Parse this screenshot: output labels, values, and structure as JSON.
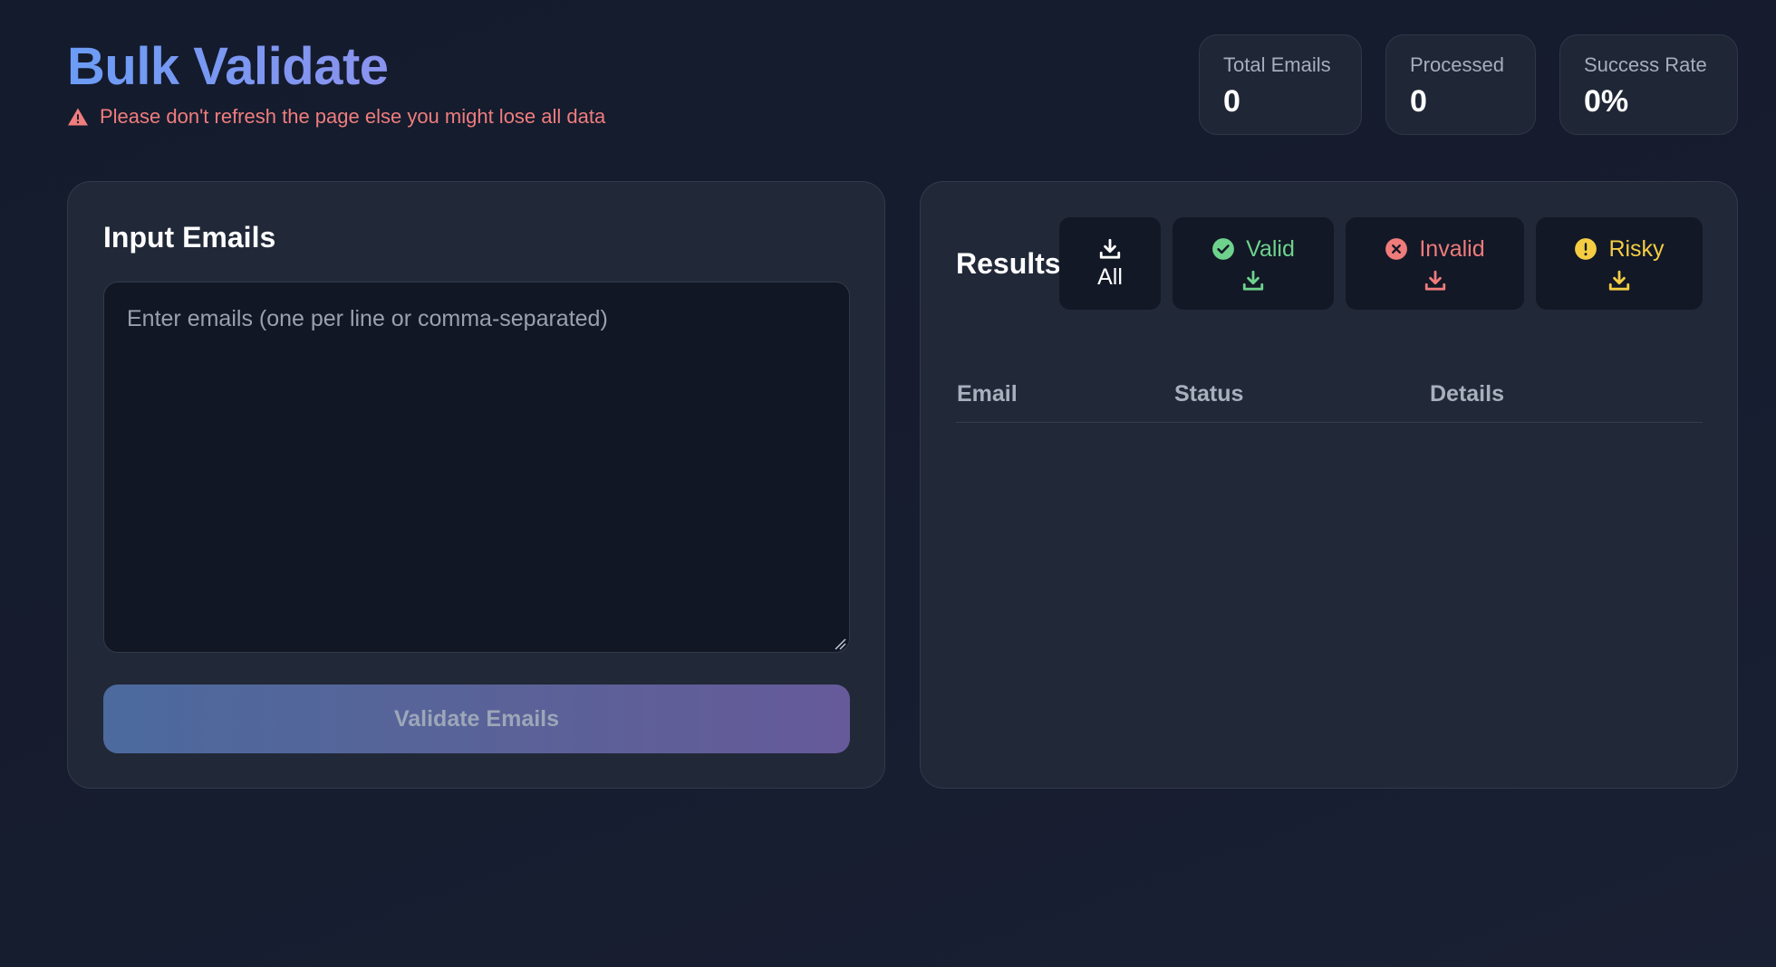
{
  "header": {
    "title": "Bulk Validate",
    "warning": "Please don't refresh the page else you might lose all data"
  },
  "stats": [
    {
      "label": "Total Emails",
      "value": "0"
    },
    {
      "label": "Processed",
      "value": "0"
    },
    {
      "label": "Success Rate",
      "value": "0%"
    }
  ],
  "input_panel": {
    "title": "Input Emails",
    "textarea_value": "",
    "textarea_placeholder": "Enter emails (one per line or comma-separated)",
    "validate_label": "Validate Emails"
  },
  "results_panel": {
    "title": "Results",
    "downloads": {
      "all": "All",
      "valid": "Valid",
      "invalid": "Invalid",
      "risky": "Risky"
    },
    "columns": [
      "Email",
      "Status",
      "Details"
    ],
    "rows": []
  },
  "colors": {
    "title_gradient_start": "#6b9cf5",
    "title_gradient_end": "#8b93ef",
    "warning": "#f07d7d",
    "valid": "#6ed28c",
    "invalid": "#ef7b7b",
    "risky": "#f4cd43",
    "background": "#141b2d",
    "panel": "#212838"
  },
  "icons": {
    "warning": "warning-triangle-icon",
    "download": "download-icon",
    "valid": "check-circle-icon",
    "invalid": "x-circle-icon",
    "risky": "exclamation-circle-icon"
  }
}
